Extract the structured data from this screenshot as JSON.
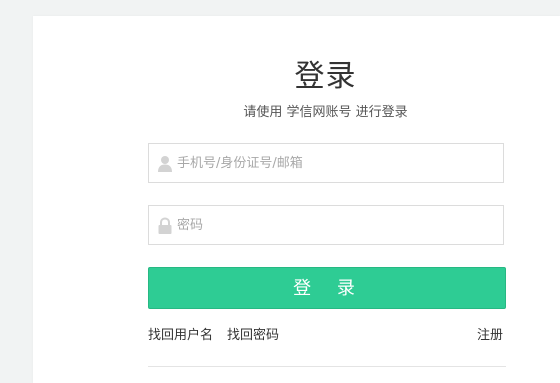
{
  "login": {
    "title": "登录",
    "subtitle": "请使用 学信网账号 进行登录",
    "username_placeholder": "手机号/身份证号/邮箱",
    "password_placeholder": "密码",
    "submit_label": "登 录",
    "links": {
      "find_username": "找回用户名",
      "find_password": "找回密码",
      "register": "注册"
    }
  },
  "colors": {
    "accent": "#2ecc94",
    "background": "#f1f3f3",
    "card": "#ffffff"
  },
  "icons": {
    "username": "user-icon",
    "password": "lock-icon"
  }
}
